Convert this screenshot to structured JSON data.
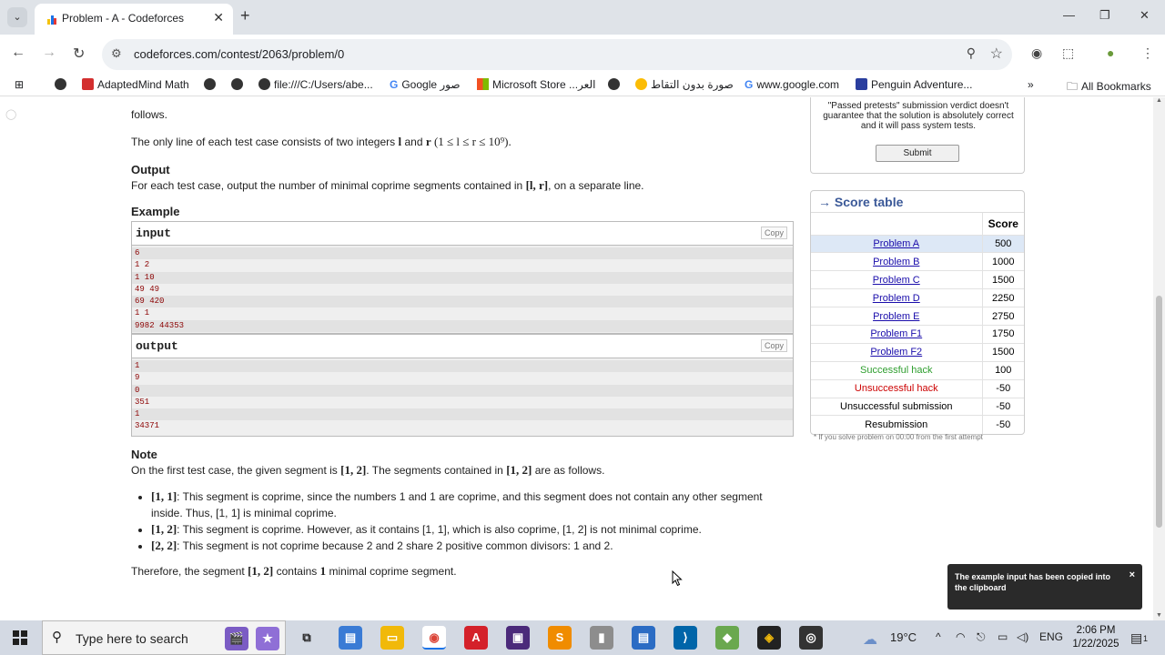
{
  "browser": {
    "tab_title": "Problem - A - Codeforces",
    "url": "codeforces.com/contest/2063/problem/0",
    "bookmarks": [
      "AdaptedMind Math",
      "file:///C:/Users/abe...",
      "Google صور",
      "Microsoft Store ...العر",
      "صورة بدون التقاط",
      "www.google.com",
      "Penguin Adventure..."
    ],
    "all_bookmarks": "All Bookmarks"
  },
  "problem": {
    "top_fragment": "follows.",
    "input_line": "The only line of each test case consists of two integers",
    "input_var_l": "l",
    "input_and": "and",
    "input_var_r": "r",
    "input_constraint": "(1 ≤ l ≤ r ≤ 10⁹).",
    "output_title": "Output",
    "output_text_a": "For each test case, output the number of minimal coprime segments contained in",
    "output_range": "[l, r]",
    "output_text_b": ", on a separate line.",
    "example_title": "Example",
    "input_label": "input",
    "output_label": "output",
    "copy_label": "Copy",
    "input_lines": [
      "6",
      "1 2",
      "1 10",
      "49 49",
      "69 420",
      "1 1",
      "9982 44353"
    ],
    "output_lines": [
      "1",
      "9",
      "0",
      "351",
      "1",
      "34371"
    ],
    "note_title": "Note",
    "note_intro_a": "On the first test case, the given segment is",
    "note_seg_12": "[1, 2]",
    "note_intro_b": ". The segments contained in",
    "note_intro_c": "are as follows.",
    "bullets": [
      {
        "seg": "[1, 1]",
        "text": ": This segment is coprime, since the numbers 1 and 1 are coprime, and this segment does not contain any other segment inside. Thus, [1, 1] is minimal coprime."
      },
      {
        "seg": "[1, 2]",
        "text": ": This segment is coprime. However, as it contains [1, 1], which is also coprime, [1, 2] is not minimal coprime."
      },
      {
        "seg": "[2, 2]",
        "text": ": This segment is not coprime because 2 and 2 share 2 positive common divisors: 1 and 2."
      }
    ],
    "conclusion_a": "Therefore, the segment",
    "conclusion_seg": "[1, 2]",
    "conclusion_b": "contains",
    "conclusion_num": "1",
    "conclusion_c": "minimal coprime segment."
  },
  "sidebar": {
    "pretests_note": "\"Passed pretests\" submission verdict doesn't guarantee that the solution is absolutely correct and it will pass system tests.",
    "submit_label": "Submit",
    "score_table_title": "→ Score table",
    "score_header": "Score",
    "rows": [
      {
        "label": "Problem A",
        "score": "500",
        "kind": "link"
      },
      {
        "label": "Problem B",
        "score": "1000",
        "kind": "link"
      },
      {
        "label": "Problem C",
        "score": "1500",
        "kind": "link"
      },
      {
        "label": "Problem D",
        "score": "2250",
        "kind": "link"
      },
      {
        "label": "Problem E",
        "score": "2750",
        "kind": "link"
      },
      {
        "label": "Problem F1",
        "score": "1750",
        "kind": "link"
      },
      {
        "label": "Problem F2",
        "score": "1500",
        "kind": "link"
      },
      {
        "label": "Successful hack",
        "score": "100",
        "kind": "green"
      },
      {
        "label": "Unsuccessful hack",
        "score": "-50",
        "kind": "red"
      },
      {
        "label": "Unsuccessful submission",
        "score": "-50",
        "kind": "plain"
      },
      {
        "label": "Resubmission",
        "score": "-50",
        "kind": "plain"
      }
    ],
    "footnote": "* If you solve problem on 00:00 from the first attempt"
  },
  "toast": {
    "text": "The example input has been copied into the clipboard",
    "close": "×"
  },
  "taskbar": {
    "search_placeholder": "Type here to search",
    "weather": "19°C",
    "language": "ENG",
    "time": "2:06 PM",
    "date": "1/22/2025",
    "notification_count": "1"
  },
  "colors": {
    "link": "#1a0dab",
    "green": "#2e9e2e",
    "red": "#cc0000",
    "accent": "#3b5998"
  }
}
